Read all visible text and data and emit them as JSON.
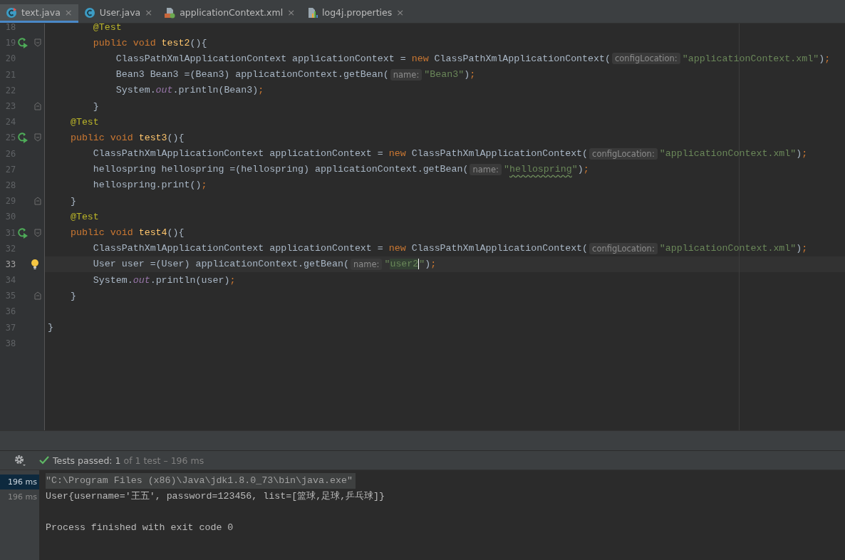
{
  "tabs": [
    {
      "label": "text.java",
      "kind": "test-class",
      "selected": true,
      "close": "×"
    },
    {
      "label": "User.java",
      "kind": "class",
      "selected": false,
      "close": "×"
    },
    {
      "label": "applicationContext.xml",
      "kind": "xml",
      "selected": false,
      "close": "×"
    },
    {
      "label": "log4j.properties",
      "kind": "properties",
      "selected": false,
      "close": "×"
    }
  ],
  "lines": [
    {
      "number": "18",
      "current": false,
      "tokens": [
        {
          "text": "        @Test",
          "kind": "annotation"
        }
      ]
    },
    {
      "number": "19",
      "current": false,
      "run": true,
      "fold_open": true,
      "tokens": [
        {
          "text": "        public void ",
          "kind": "keyword"
        },
        {
          "text": "test2",
          "kind": "method"
        },
        {
          "text": "(){",
          "kind": "plain"
        }
      ]
    },
    {
      "number": "20",
      "current": false,
      "tokens": [
        {
          "text": "            ClassPathXmlApplicationContext applicationContext = ",
          "kind": "plain"
        },
        {
          "text": "new",
          "kind": "keyword"
        },
        {
          "text": " ClassPathXmlApplicationContext(",
          "kind": "plain"
        },
        {
          "text": "configLocation:",
          "kind": "hint"
        },
        {
          "text": "\"applicationContext.xml\"",
          "kind": "string"
        },
        {
          "text": ")",
          "kind": "plain"
        },
        {
          "text": ";",
          "kind": "keyword"
        }
      ]
    },
    {
      "number": "21",
      "current": false,
      "tokens": [
        {
          "text": "            Bean3 Bean3 =(Bean3) applicationContext.getBean(",
          "kind": "plain"
        },
        {
          "text": "name:",
          "kind": "hint"
        },
        {
          "text": "\"Bean3\"",
          "kind": "string"
        },
        {
          "text": ")",
          "kind": "plain"
        },
        {
          "text": ";",
          "kind": "keyword"
        }
      ]
    },
    {
      "number": "22",
      "current": false,
      "tokens": [
        {
          "text": "            System.",
          "kind": "plain"
        },
        {
          "text": "out",
          "kind": "field"
        },
        {
          "text": ".println(Bean3)",
          "kind": "plain"
        },
        {
          "text": ";",
          "kind": "keyword"
        }
      ]
    },
    {
      "number": "23",
      "current": false,
      "fold_close": true,
      "tokens": [
        {
          "text": "        }",
          "kind": "plain"
        }
      ]
    },
    {
      "number": "24",
      "current": false,
      "tokens": [
        {
          "text": "    @Test",
          "kind": "annotation"
        }
      ]
    },
    {
      "number": "25",
      "current": false,
      "run": true,
      "fold_open": true,
      "tokens": [
        {
          "text": "    public void ",
          "kind": "keyword"
        },
        {
          "text": "test3",
          "kind": "method"
        },
        {
          "text": "(){",
          "kind": "plain"
        }
      ]
    },
    {
      "number": "26",
      "current": false,
      "tokens": [
        {
          "text": "        ClassPathXmlApplicationContext applicationContext = ",
          "kind": "plain"
        },
        {
          "text": "new",
          "kind": "keyword"
        },
        {
          "text": " ClassPathXmlApplicationContext(",
          "kind": "plain"
        },
        {
          "text": "configLocation:",
          "kind": "hint"
        },
        {
          "text": "\"applicationContext.xml\"",
          "kind": "string"
        },
        {
          "text": ")",
          "kind": "plain"
        },
        {
          "text": ";",
          "kind": "keyword"
        }
      ]
    },
    {
      "number": "27",
      "current": false,
      "tokens": [
        {
          "text": "        hellospring hellospring =(hellospring) applicationContext.getBean(",
          "kind": "plain"
        },
        {
          "text": "name:",
          "kind": "hint"
        },
        {
          "text": "\"",
          "kind": "string"
        },
        {
          "text": "hellospring",
          "kind": "string",
          "typo": true
        },
        {
          "text": "\"",
          "kind": "string"
        },
        {
          "text": ")",
          "kind": "plain"
        },
        {
          "text": ";",
          "kind": "keyword"
        }
      ]
    },
    {
      "number": "28",
      "current": false,
      "tokens": [
        {
          "text": "        hellospring.print()",
          "kind": "plain"
        },
        {
          "text": ";",
          "kind": "keyword"
        }
      ]
    },
    {
      "number": "29",
      "current": false,
      "fold_close": true,
      "tokens": [
        {
          "text": "    }",
          "kind": "plain"
        }
      ]
    },
    {
      "number": "30",
      "current": false,
      "tokens": [
        {
          "text": "    @Test",
          "kind": "annotation"
        }
      ]
    },
    {
      "number": "31",
      "current": false,
      "run": true,
      "fold_open": true,
      "tokens": [
        {
          "text": "    public void ",
          "kind": "keyword"
        },
        {
          "text": "test4",
          "kind": "method"
        },
        {
          "text": "(){",
          "kind": "plain"
        }
      ]
    },
    {
      "number": "32",
      "current": false,
      "tokens": [
        {
          "text": "        ClassPathXmlApplicationContext applicationContext = ",
          "kind": "plain"
        },
        {
          "text": "new",
          "kind": "keyword"
        },
        {
          "text": " ClassPathXmlApplicationContext(",
          "kind": "plain"
        },
        {
          "text": "configLocation:",
          "kind": "hint"
        },
        {
          "text": "\"applicationContext.xml\"",
          "kind": "string"
        },
        {
          "text": ")",
          "kind": "plain"
        },
        {
          "text": ";",
          "kind": "keyword"
        }
      ]
    },
    {
      "number": "33",
      "current": true,
      "bulb": true,
      "tokens": [
        {
          "text": "        User user =(User) applicationContext.getBean(",
          "kind": "plain"
        },
        {
          "text": "name:",
          "kind": "hint"
        },
        {
          "text": "\"",
          "kind": "string"
        },
        {
          "text": "user2",
          "kind": "string",
          "highlight": true,
          "caret": true
        },
        {
          "text": "\"",
          "kind": "string"
        },
        {
          "text": ")",
          "kind": "plain"
        },
        {
          "text": ";",
          "kind": "keyword"
        }
      ]
    },
    {
      "number": "34",
      "current": false,
      "tokens": [
        {
          "text": "        System.",
          "kind": "plain"
        },
        {
          "text": "out",
          "kind": "field"
        },
        {
          "text": ".println(user)",
          "kind": "plain"
        },
        {
          "text": ";",
          "kind": "keyword"
        }
      ]
    },
    {
      "number": "35",
      "current": false,
      "fold_close": true,
      "tokens": [
        {
          "text": "    }",
          "kind": "plain"
        }
      ]
    },
    {
      "number": "36",
      "current": false
    },
    {
      "number": "37",
      "current": false,
      "tokens": [
        {
          "text": "}",
          "kind": "plain"
        }
      ]
    },
    {
      "number": "38",
      "current": false
    }
  ],
  "run_panel": {
    "status": "Tests passed:",
    "count": "1",
    "detail": "of 1 test – 196 ms",
    "times": [
      {
        "text": "196 ms",
        "selected": true
      },
      {
        "text": "196 ms",
        "selected": false
      }
    ],
    "console": [
      {
        "text": "\"C:\\Program Files (x86)\\Java\\jdk1.8.0_73\\bin\\java.exe\"",
        "selected": true
      },
      {
        "text": "User{username='王五', password=123456, list=[篮球,足球,乒乓球]}",
        "selected": false
      }
    ],
    "exit_message": "Process finished with exit code 0"
  }
}
